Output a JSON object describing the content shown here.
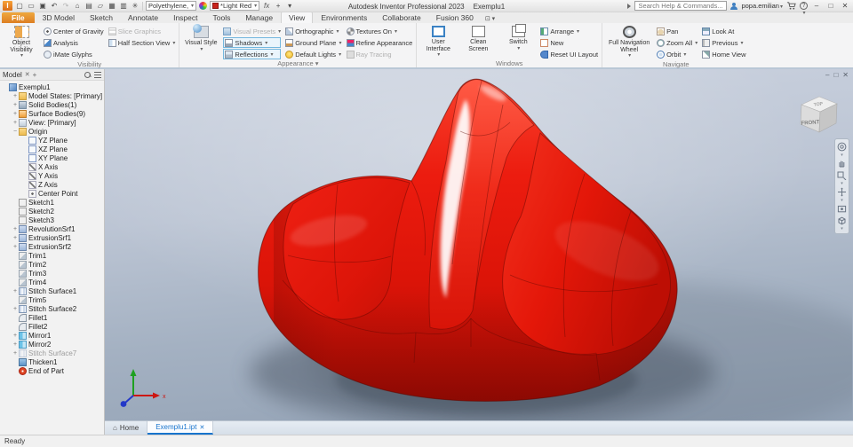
{
  "titlebar": {
    "logo_letter": "I",
    "app_title": "Autodesk Inventor Professional 2023",
    "doc_title": "Exemplu1",
    "search_placeholder": "Search Help & Commands...",
    "user_name": "popa.emilian",
    "help_label": "?",
    "window_minimize": "–",
    "window_maximize": "□",
    "window_close": "✕"
  },
  "quick_access": {
    "icons": [
      {
        "name": "new-file-icon",
        "glyph": "▢"
      },
      {
        "name": "open-icon",
        "glyph": "▭"
      },
      {
        "name": "save-icon",
        "glyph": "▣"
      },
      {
        "name": "undo-icon",
        "glyph": "↶"
      },
      {
        "name": "redo-icon",
        "glyph": "↷",
        "dim": true
      },
      {
        "name": "home-icon",
        "glyph": "⌂"
      },
      {
        "name": "drawing-icon",
        "glyph": "▤"
      },
      {
        "name": "share-view-icon",
        "glyph": "▱"
      },
      {
        "name": "image-icon",
        "glyph": "▦"
      },
      {
        "name": "shared-user-icon",
        "glyph": "▥"
      },
      {
        "name": "gear-icon",
        "glyph": "✳"
      }
    ],
    "material_value": "Polyethylene,",
    "appearance_value": "*Light Red",
    "fx_label": "fx",
    "plus_label": "+",
    "overflow_label": "▾"
  },
  "tabs": {
    "items": [
      "File",
      "3D Model",
      "Sketch",
      "Annotate",
      "Inspect",
      "Tools",
      "Manage",
      "View",
      "Environments",
      "Collaborate",
      "Fusion 360"
    ],
    "active": "View"
  },
  "ribbon": {
    "object_visibility": "Object Visibility",
    "center_of_gravity": "Center of Gravity",
    "analysis": "Analysis",
    "imate_glyphs": "iMate Glyphs",
    "slice_graphics": "Slice Graphics",
    "half_section_view": "Half Section View",
    "visibility_label": "Visibility",
    "visual_style": "Visual Style",
    "visual_presets": "Visual Presets",
    "shadows": "Shadows",
    "reflections": "Reflections",
    "orthographic": "Orthographic",
    "ground_plane": "Ground Plane",
    "default_lights": "Default Lights",
    "textures_on": "Textures On",
    "refine_appearance": "Refine Appearance",
    "ray_tracing": "Ray Tracing",
    "appearance_label": "Appearance ▾",
    "user_interface": "User Interface",
    "clean_screen": "Clean Screen",
    "switch": "Switch",
    "arrange": "Arrange",
    "new_window": "New",
    "reset_ui_layout": "Reset UI Layout",
    "windows_label": "Windows",
    "full_navigation_wheel": "Full Navigation Wheel",
    "pan": "Pan",
    "zoom_all": "Zoom All",
    "orbit": "Orbit",
    "look_at": "Look At",
    "previous": "Previous",
    "home_view": "Home View",
    "navigate_label": "Navigate"
  },
  "browser": {
    "tab_label": "Model",
    "tab_close": "✕",
    "tab_add": "+",
    "tree": [
      {
        "label": "Exemplu1",
        "icon": "doc",
        "depth": 0,
        "exp": ""
      },
      {
        "label": "Model States: [Primary]",
        "icon": "folder",
        "depth": 1,
        "exp": "+"
      },
      {
        "label": "Solid Bodies(1)",
        "icon": "solid",
        "depth": 1,
        "exp": "+"
      },
      {
        "label": "Surface Bodies(9)",
        "icon": "surface",
        "depth": 1,
        "exp": "+"
      },
      {
        "label": "View: [Primary]",
        "icon": "view",
        "depth": 1,
        "exp": "+"
      },
      {
        "label": "Origin",
        "icon": "folder",
        "depth": 1,
        "exp": "−"
      },
      {
        "label": "YZ Plane",
        "icon": "plane",
        "depth": 2,
        "exp": ""
      },
      {
        "label": "XZ Plane",
        "icon": "plane",
        "depth": 2,
        "exp": ""
      },
      {
        "label": "XY Plane",
        "icon": "plane",
        "depth": 2,
        "exp": ""
      },
      {
        "label": "X Axis",
        "icon": "axis",
        "depth": 2,
        "exp": ""
      },
      {
        "label": "Y Axis",
        "icon": "axis",
        "depth": 2,
        "exp": ""
      },
      {
        "label": "Z Axis",
        "icon": "axis",
        "depth": 2,
        "exp": ""
      },
      {
        "label": "Center Point",
        "icon": "point",
        "depth": 2,
        "exp": ""
      },
      {
        "label": "Sketch1",
        "icon": "sketch",
        "depth": 1,
        "exp": ""
      },
      {
        "label": "Sketch2",
        "icon": "sketch",
        "depth": 1,
        "exp": ""
      },
      {
        "label": "Sketch3",
        "icon": "sketch",
        "depth": 1,
        "exp": ""
      },
      {
        "label": "RevolutionSrf1",
        "icon": "feature",
        "depth": 1,
        "exp": "+"
      },
      {
        "label": "ExtrusionSrf1",
        "icon": "feature",
        "depth": 1,
        "exp": "+"
      },
      {
        "label": "ExtrusionSrf2",
        "icon": "feature",
        "depth": 1,
        "exp": "+"
      },
      {
        "label": "Trim1",
        "icon": "trim",
        "depth": 1,
        "exp": ""
      },
      {
        "label": "Trim2",
        "icon": "trim",
        "depth": 1,
        "exp": ""
      },
      {
        "label": "Trim3",
        "icon": "trim",
        "depth": 1,
        "exp": ""
      },
      {
        "label": "Trim4",
        "icon": "trim",
        "depth": 1,
        "exp": ""
      },
      {
        "label": "Stitch Surface1",
        "icon": "stitch",
        "depth": 1,
        "exp": "+"
      },
      {
        "label": "Trim5",
        "icon": "trim",
        "depth": 1,
        "exp": ""
      },
      {
        "label": "Stitch Surface2",
        "icon": "stitch",
        "depth": 1,
        "exp": "+"
      },
      {
        "label": "Fillet1",
        "icon": "fillet",
        "depth": 1,
        "exp": ""
      },
      {
        "label": "Fillet2",
        "icon": "fillet",
        "depth": 1,
        "exp": ""
      },
      {
        "label": "Mirror1",
        "icon": "mirror",
        "depth": 1,
        "exp": "+"
      },
      {
        "label": "Mirror2",
        "icon": "mirror",
        "depth": 1,
        "exp": "+"
      },
      {
        "label": "Stitch Surface7",
        "icon": "stitch",
        "depth": 1,
        "exp": "+",
        "gray": true
      },
      {
        "label": "Thicken1",
        "icon": "thicken",
        "depth": 1,
        "exp": ""
      },
      {
        "label": "End of Part",
        "icon": "eop",
        "depth": 1,
        "exp": ""
      }
    ]
  },
  "viewport": {
    "viewcube_front": "FRONT",
    "viewcube_top": "TOP",
    "axis_x_label": "x",
    "win_minimize": "–",
    "win_restore": "□",
    "win_close": "✕"
  },
  "doc_tabs": {
    "home_label": "Home",
    "active_label": "Exemplu1.ipt",
    "close_glyph": "✕"
  },
  "statusbar": {
    "text": "Ready"
  },
  "colors": {
    "model_red": "#e8170d",
    "file_tab_orange": "#e8962f",
    "active_doc_blue": "#1874cd",
    "toggle_border_blue": "#74b7de"
  }
}
